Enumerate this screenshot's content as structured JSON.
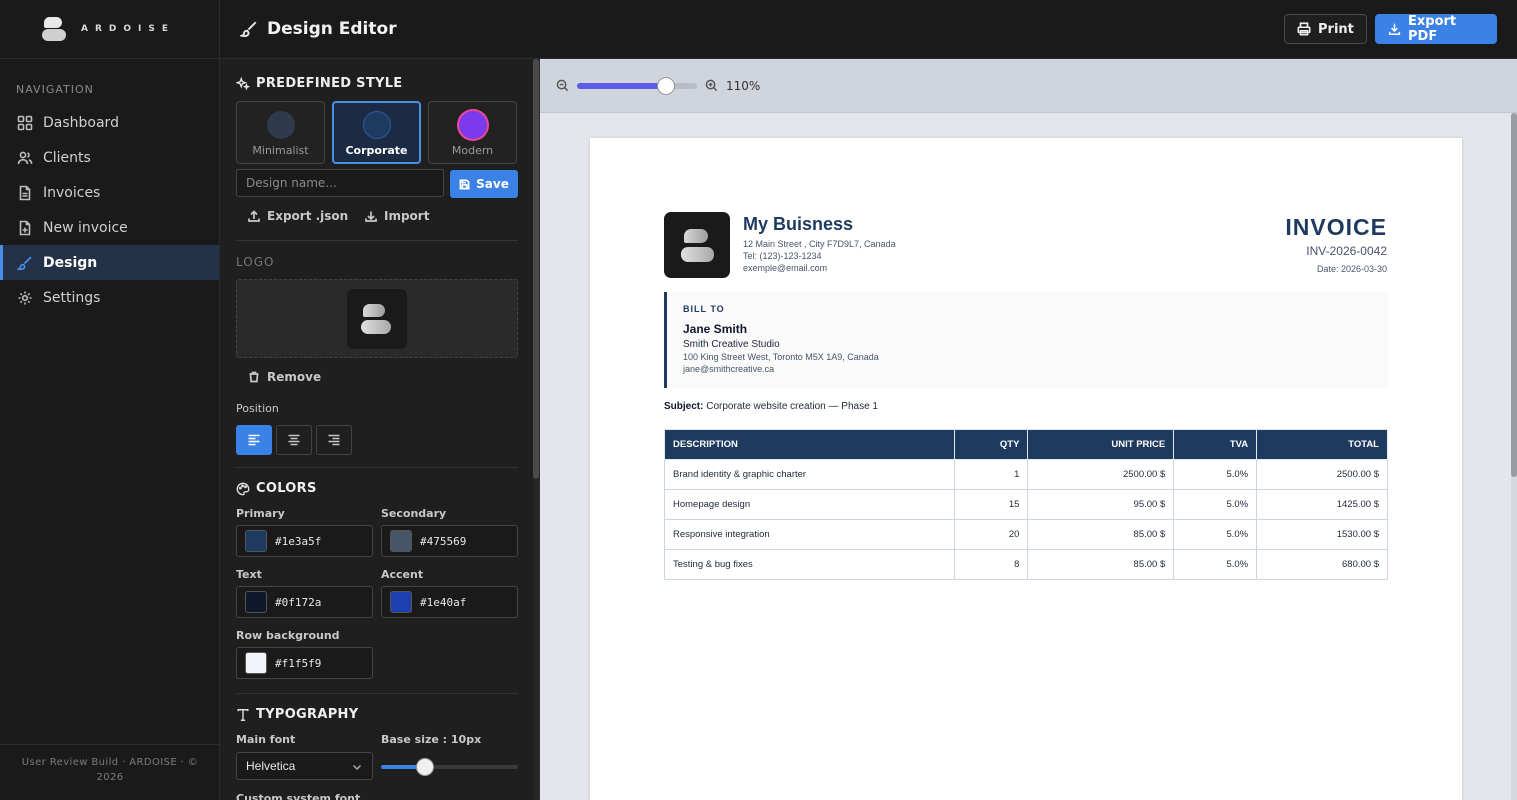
{
  "brand": {
    "name": "ARDOISE"
  },
  "sidebar": {
    "nav_title": "NAVIGATION",
    "items": [
      {
        "label": "Dashboard",
        "icon": "grid-icon"
      },
      {
        "label": "Clients",
        "icon": "users-icon"
      },
      {
        "label": "Invoices",
        "icon": "file-icon"
      },
      {
        "label": "New invoice",
        "icon": "file-plus-icon"
      },
      {
        "label": "Design",
        "icon": "brush-icon",
        "active": true
      },
      {
        "label": "Settings",
        "icon": "gear-icon"
      }
    ],
    "footer": "User Review Build · ARDOISE · © 2026"
  },
  "header": {
    "title": "Design Editor",
    "print_label": "Print",
    "export_label": "Export PDF"
  },
  "editor": {
    "predefined_title": "PREDEFINED STYLE",
    "styles": [
      {
        "label": "Minimalist",
        "color": "#2f3a4d"
      },
      {
        "label": "Corporate",
        "color": "#1e3a5f",
        "selected": true
      },
      {
        "label": "Modern",
        "color": "#7c3aed"
      }
    ],
    "design_name_placeholder": "Design name...",
    "save_label": "Save",
    "export_json_label": "Export .json",
    "import_label": "Import",
    "logo_title": "LOGO",
    "remove_label": "Remove",
    "position_label": "Position",
    "colors_title": "COLORS",
    "colors": {
      "primary": {
        "label": "Primary",
        "value": "#1e3a5f"
      },
      "secondary": {
        "label": "Secondary",
        "value": "#475569"
      },
      "text": {
        "label": "Text",
        "value": "#0f172a"
      },
      "accent": {
        "label": "Accent",
        "value": "#1e40af"
      },
      "row_background": {
        "label": "Row background",
        "value": "#f1f5f9"
      }
    },
    "typography_title": "TYPOGRAPHY",
    "main_font_label": "Main font",
    "main_font_value": "Helvetica",
    "base_size_label": "Base size : 10px",
    "base_size_fraction": 0.32,
    "custom_font_label": "Custom system font"
  },
  "preview": {
    "zoom_label": "110%",
    "zoom_fraction": 0.74
  },
  "invoice": {
    "business_name": "My Buisness",
    "business_address": "12 Main Street , City F7D9L7, Canada",
    "business_tel": "Tel: (123)-123-1234",
    "business_email": "exemple@email.com",
    "title": "INVOICE",
    "number": "INV-2026-0042",
    "date": "Date: 2026-03-30",
    "bill_to_label": "BILL TO",
    "client_name": "Jane Smith",
    "client_company": "Smith Creative Studio",
    "client_address": "100 King Street West, Toronto M5X 1A9, Canada",
    "client_email": "jane@smithcreative.ca",
    "subject_label": "Subject:",
    "subject": "Corporate website creation — Phase 1",
    "columns": [
      "DESCRIPTION",
      "QTY",
      "UNIT PRICE",
      "TVA",
      "TOTAL"
    ],
    "rows": [
      [
        "Brand identity & graphic charter",
        "1",
        "2500.00 $",
        "5.0%",
        "2500.00 $"
      ],
      [
        "Homepage design",
        "15",
        "95.00 $",
        "5.0%",
        "1425.00 $"
      ],
      [
        "Responsive integration",
        "20",
        "85.00 $",
        "5.0%",
        "1530.00 $"
      ],
      [
        "Testing & bug fixes",
        "8",
        "85.00 $",
        "5.0%",
        "680.00 $"
      ]
    ]
  }
}
